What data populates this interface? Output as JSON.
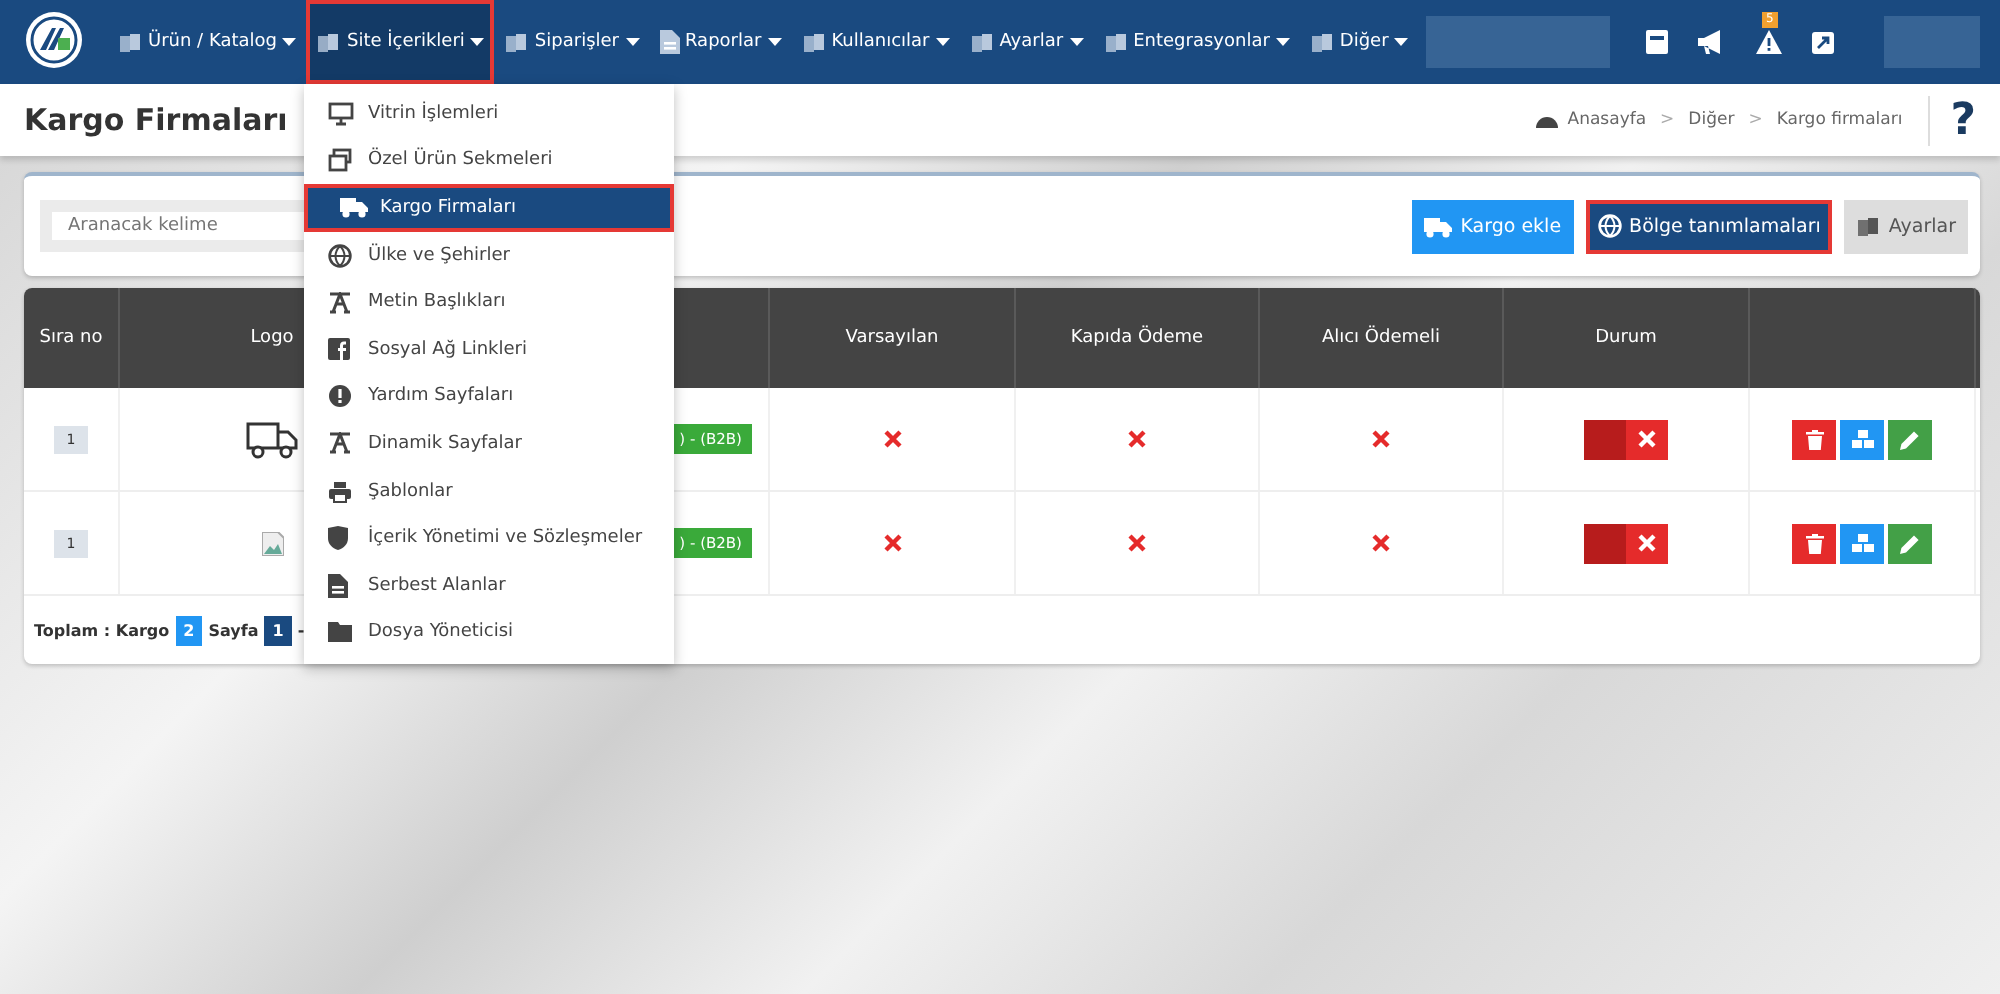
{
  "nav": {
    "items": [
      {
        "label": "Ürün / Katalog",
        "open": false,
        "highlighted": false
      },
      {
        "label": "Site İçerikleri",
        "open": true,
        "highlighted": true
      },
      {
        "label": "Siparişler",
        "open": false,
        "highlighted": false
      },
      {
        "label": "Raporlar",
        "open": false,
        "highlighted": false
      },
      {
        "label": "Kullanıcılar",
        "open": false,
        "highlighted": false
      },
      {
        "label": "Ayarlar",
        "open": false,
        "highlighted": false
      },
      {
        "label": "Entegrasyonlar",
        "open": false,
        "highlighted": false
      },
      {
        "label": "Diğer",
        "open": false,
        "highlighted": false
      }
    ],
    "notification_count": "5"
  },
  "page": {
    "title": "Kargo Firmaları",
    "help": "?"
  },
  "breadcrumb": {
    "items": [
      "Anasayfa",
      "Diğer",
      "Kargo firmaları"
    ],
    "separators": [
      ">",
      ">"
    ]
  },
  "dropdown": [
    {
      "label": "Vitrin İşlemleri",
      "selected": false
    },
    {
      "label": "Özel Ürün Sekmeleri",
      "selected": false
    },
    {
      "label": "Kargo Firmaları",
      "selected": true
    },
    {
      "label": "Ülke ve Şehirler",
      "selected": false
    },
    {
      "label": "Metin Başlıkları",
      "selected": false
    },
    {
      "label": "Sosyal Ağ Linkleri",
      "selected": false
    },
    {
      "label": "Yardım Sayfaları",
      "selected": false
    },
    {
      "label": "Dinamik Sayfalar",
      "selected": false
    },
    {
      "label": "Şablonlar",
      "selected": false
    },
    {
      "label": "İçerik Yönetimi ve Sözleşmeler",
      "selected": false
    },
    {
      "label": "Serbest Alanlar",
      "selected": false
    },
    {
      "label": "Dosya Yöneticisi",
      "selected": false
    }
  ],
  "search": {
    "placeholder": "Aranacak kelime"
  },
  "buttons": [
    {
      "label": "Kargo ekle",
      "kind": "add",
      "highlighted": false
    },
    {
      "label": "Bölge tanımlamaları",
      "kind": "region",
      "highlighted": true
    },
    {
      "label": "Ayarlar",
      "kind": "settings",
      "highlighted": false
    }
  ],
  "table": {
    "columns": [
      "Sıra no",
      "Logo",
      "",
      "Varsayılan",
      "Kapıda Ödeme",
      "Alıcı Ödemeli",
      "Durum",
      ""
    ],
    "rows": [
      {
        "order": "1",
        "logo": {
          "kind": "truck"
        },
        "tag": ") - (B2B)",
        "default": false,
        "cash_on_delivery": false,
        "receiver_pays": false,
        "active": false
      },
      {
        "order": "1",
        "logo": {
          "kind": "broken"
        },
        "tag": ") - (B2B)",
        "default": false,
        "cash_on_delivery": false,
        "receiver_pays": false,
        "active": false
      }
    ]
  },
  "footer": {
    "total_label": "Toplam : Kargo",
    "total": "2",
    "page_label": "Sayfa",
    "page": "1",
    "separator": "-"
  }
}
